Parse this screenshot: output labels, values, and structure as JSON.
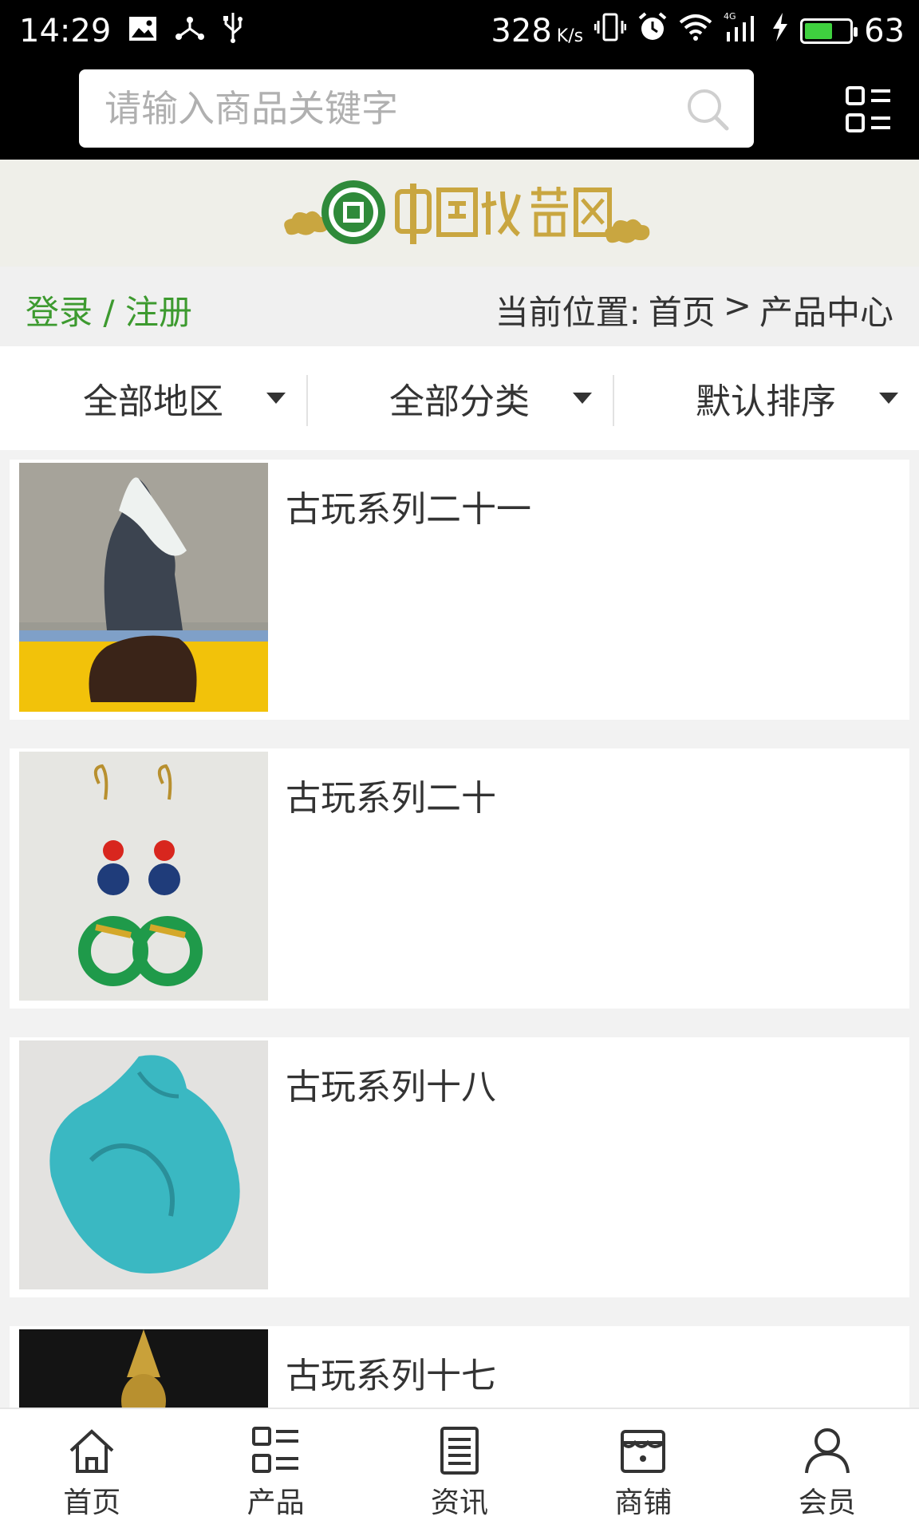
{
  "status_bar": {
    "time": "14:29",
    "speed": "328",
    "speed_unit": "K/s",
    "battery": "63",
    "battery_level": 0.63,
    "network": "4G"
  },
  "search": {
    "placeholder": "请输入商品关键字"
  },
  "header": {
    "login_link": "登录 / 注册",
    "location_label": "当前位置:",
    "location_home": "首页",
    "location_sep": ">",
    "location_current": "产品中心"
  },
  "filters": [
    {
      "label": "全部地区"
    },
    {
      "label": "全部分类"
    },
    {
      "label": "默认排序"
    }
  ],
  "products": [
    {
      "title": "古玩系列二十一"
    },
    {
      "title": "古玩系列二十"
    },
    {
      "title": "古玩系列十八"
    },
    {
      "title": "古玩系列十七"
    }
  ],
  "tabs": [
    {
      "label": "首页",
      "icon": "home-icon"
    },
    {
      "label": "产品",
      "icon": "grid-icon"
    },
    {
      "label": "资讯",
      "icon": "document-icon"
    },
    {
      "label": "商铺",
      "icon": "store-icon"
    },
    {
      "label": "会员",
      "icon": "user-icon"
    }
  ],
  "colors": {
    "accent_green": "#3d9a2f",
    "logo_gold": "#c9a640",
    "battery_green": "#3fd13f"
  }
}
